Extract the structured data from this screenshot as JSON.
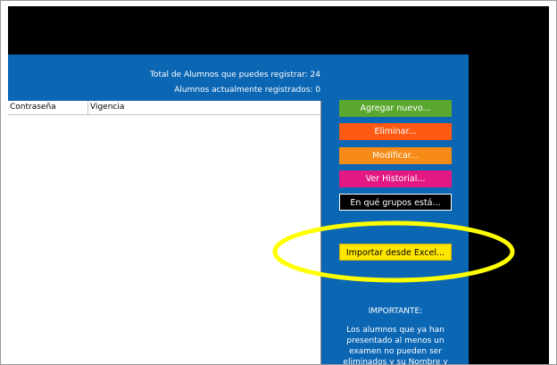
{
  "stats": {
    "total": "Total de Alumnos que puedes registrar: 24",
    "registered": "Alumnos actualmente registrados:  0"
  },
  "table": {
    "columns": [
      "Contraseña",
      "Vigencia"
    ]
  },
  "buttons": {
    "add": "Agregar nuevo...",
    "delete": "Eliminar...",
    "modify": "Modificar...",
    "history": "Ver Historial...",
    "groups": "En qué grupos está...",
    "import": "Importar desde Excel..."
  },
  "notice": {
    "title": "IMPORTANTE:",
    "text": "Los alumnos que ya han presentado al menos un examen no pueden ser eliminados y su Nombre y"
  },
  "colors": {
    "panel": "#0b66b4",
    "add": "#5aa72e",
    "delete": "#ff5a14",
    "modify": "#f58a16",
    "history": "#e21983",
    "groups": "#000000",
    "import": "#ffe600",
    "highlight_ring": "#ffff00"
  }
}
